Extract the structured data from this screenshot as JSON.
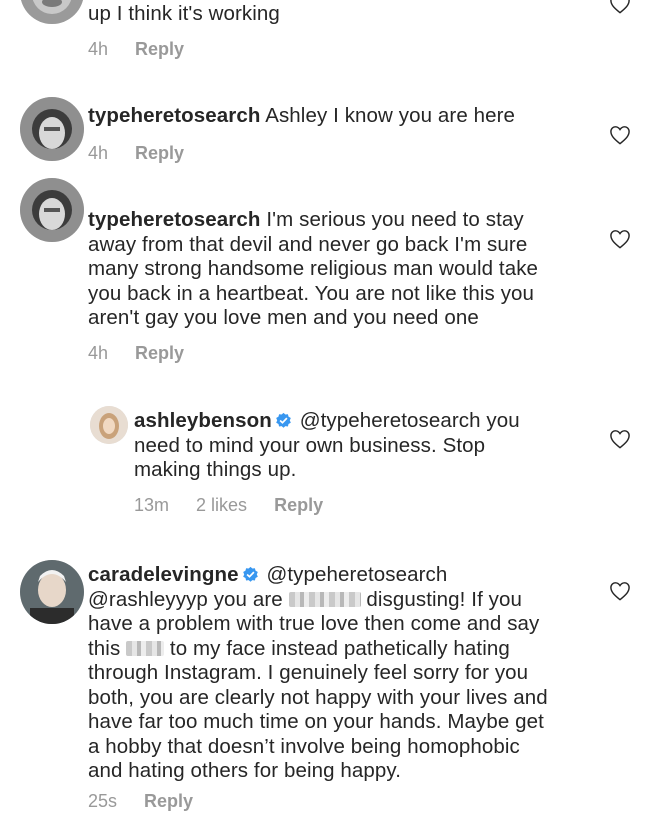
{
  "comments": [
    {
      "username": "",
      "text": "up I think it's working",
      "time": "4h",
      "likes": "",
      "reply_label": "Reply"
    },
    {
      "username": "typeheretosearch",
      "text": "Ashley I know you are here",
      "time": "4h",
      "likes": "",
      "reply_label": "Reply"
    },
    {
      "username": "typeheretosearch",
      "text_lines": [
        "I'm serious you need to stay",
        "away from that devil and never go back I'm sure",
        "many strong handsome religious man would take",
        "you back in a heartbeat. You are not like this you",
        "aren't gay you love men and you need one"
      ],
      "time": "4h",
      "likes": "",
      "reply_label": "Reply"
    },
    {
      "username": "ashleybenson",
      "verified": true,
      "text_lines": [
        "@typeheretosearch you",
        "need to mind your own business. Stop",
        "making things up."
      ],
      "time": "13m",
      "likes": "2 likes",
      "reply_label": "Reply"
    },
    {
      "username": "caradelevingne",
      "verified": true,
      "text_lines": [
        "@typeheretosearch",
        "@rashleyyyp you are",
        "disgusting! If you",
        "have a problem with  true love then come and say",
        "this",
        "to my face instead pathetically hating",
        "through Instagram. I genuinely feel sorry for you",
        "both, you are clearly not happy with your lives and",
        "have far too much time on your hands. Maybe get",
        "a hobby that doesn’t involve being homophobic",
        "and hating others for being happy."
      ],
      "time": "25s",
      "likes": "",
      "reply_label": "Reply"
    }
  ],
  "colors": {
    "text": "#262626",
    "meta": "#999999",
    "verified": "#3897f0",
    "heart_stroke": "#262626"
  },
  "icons": {
    "like": "heart-outline-icon",
    "verified": "verified-badge-icon"
  }
}
